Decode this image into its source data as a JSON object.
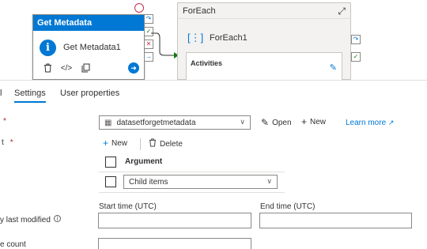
{
  "canvas": {
    "get_metadata": {
      "type_label": "Get Metadata",
      "name": "Get Metadata1",
      "icon": "info-icon",
      "tools": [
        "delete-icon",
        "code-icon",
        "copy-icon",
        "go-arrow-icon"
      ]
    },
    "foreach": {
      "title": "ForEach",
      "name": "ForEach1",
      "activities_label": "Activities"
    },
    "colors": {
      "accent": "#0078d4",
      "success": "#107c10",
      "failure": "#c4314b"
    }
  },
  "panel": {
    "tabs": [
      {
        "label": "l"
      },
      {
        "label": "Settings"
      },
      {
        "label": "User properties"
      }
    ],
    "active_tab": "Settings",
    "dataset": {
      "label_fragment": "*",
      "selected": "datasetforgetmetadata",
      "open_label": "Open",
      "new_label": "New",
      "learn_more": "Learn more"
    },
    "field_list": {
      "label_fragment": "t",
      "required_mark": "*",
      "new_label": "New",
      "delete_label": "Delete",
      "column_header": "Argument",
      "rows": [
        {
          "value": "Child items"
        }
      ]
    },
    "filter": {
      "label_fragment": "y last modified",
      "start_label": "Start time (UTC)",
      "end_label": "End time (UTC)"
    },
    "count": {
      "label_fragment": "e count"
    }
  }
}
